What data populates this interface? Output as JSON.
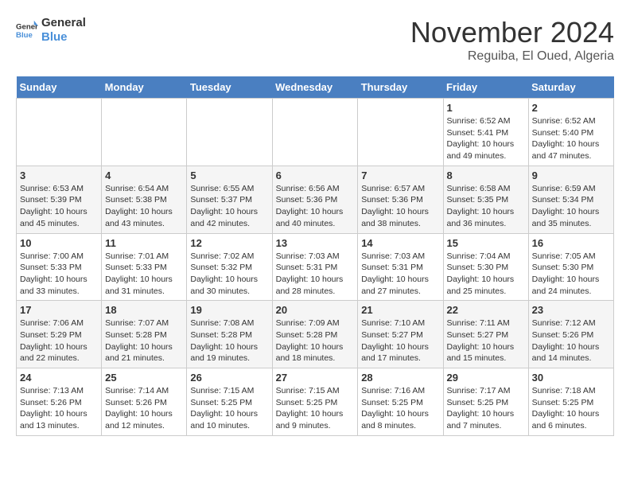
{
  "logo": {
    "line1": "General",
    "line2": "Blue"
  },
  "title": "November 2024",
  "subtitle": "Reguiba, El Oued, Algeria",
  "weekdays": [
    "Sunday",
    "Monday",
    "Tuesday",
    "Wednesday",
    "Thursday",
    "Friday",
    "Saturday"
  ],
  "weeks": [
    [
      {
        "day": "",
        "info": ""
      },
      {
        "day": "",
        "info": ""
      },
      {
        "day": "",
        "info": ""
      },
      {
        "day": "",
        "info": ""
      },
      {
        "day": "",
        "info": ""
      },
      {
        "day": "1",
        "info": "Sunrise: 6:52 AM\nSunset: 5:41 PM\nDaylight: 10 hours and 49 minutes."
      },
      {
        "day": "2",
        "info": "Sunrise: 6:52 AM\nSunset: 5:40 PM\nDaylight: 10 hours and 47 minutes."
      }
    ],
    [
      {
        "day": "3",
        "info": "Sunrise: 6:53 AM\nSunset: 5:39 PM\nDaylight: 10 hours and 45 minutes."
      },
      {
        "day": "4",
        "info": "Sunrise: 6:54 AM\nSunset: 5:38 PM\nDaylight: 10 hours and 43 minutes."
      },
      {
        "day": "5",
        "info": "Sunrise: 6:55 AM\nSunset: 5:37 PM\nDaylight: 10 hours and 42 minutes."
      },
      {
        "day": "6",
        "info": "Sunrise: 6:56 AM\nSunset: 5:36 PM\nDaylight: 10 hours and 40 minutes."
      },
      {
        "day": "7",
        "info": "Sunrise: 6:57 AM\nSunset: 5:36 PM\nDaylight: 10 hours and 38 minutes."
      },
      {
        "day": "8",
        "info": "Sunrise: 6:58 AM\nSunset: 5:35 PM\nDaylight: 10 hours and 36 minutes."
      },
      {
        "day": "9",
        "info": "Sunrise: 6:59 AM\nSunset: 5:34 PM\nDaylight: 10 hours and 35 minutes."
      }
    ],
    [
      {
        "day": "10",
        "info": "Sunrise: 7:00 AM\nSunset: 5:33 PM\nDaylight: 10 hours and 33 minutes."
      },
      {
        "day": "11",
        "info": "Sunrise: 7:01 AM\nSunset: 5:33 PM\nDaylight: 10 hours and 31 minutes."
      },
      {
        "day": "12",
        "info": "Sunrise: 7:02 AM\nSunset: 5:32 PM\nDaylight: 10 hours and 30 minutes."
      },
      {
        "day": "13",
        "info": "Sunrise: 7:03 AM\nSunset: 5:31 PM\nDaylight: 10 hours and 28 minutes."
      },
      {
        "day": "14",
        "info": "Sunrise: 7:03 AM\nSunset: 5:31 PM\nDaylight: 10 hours and 27 minutes."
      },
      {
        "day": "15",
        "info": "Sunrise: 7:04 AM\nSunset: 5:30 PM\nDaylight: 10 hours and 25 minutes."
      },
      {
        "day": "16",
        "info": "Sunrise: 7:05 AM\nSunset: 5:30 PM\nDaylight: 10 hours and 24 minutes."
      }
    ],
    [
      {
        "day": "17",
        "info": "Sunrise: 7:06 AM\nSunset: 5:29 PM\nDaylight: 10 hours and 22 minutes."
      },
      {
        "day": "18",
        "info": "Sunrise: 7:07 AM\nSunset: 5:28 PM\nDaylight: 10 hours and 21 minutes."
      },
      {
        "day": "19",
        "info": "Sunrise: 7:08 AM\nSunset: 5:28 PM\nDaylight: 10 hours and 19 minutes."
      },
      {
        "day": "20",
        "info": "Sunrise: 7:09 AM\nSunset: 5:28 PM\nDaylight: 10 hours and 18 minutes."
      },
      {
        "day": "21",
        "info": "Sunrise: 7:10 AM\nSunset: 5:27 PM\nDaylight: 10 hours and 17 minutes."
      },
      {
        "day": "22",
        "info": "Sunrise: 7:11 AM\nSunset: 5:27 PM\nDaylight: 10 hours and 15 minutes."
      },
      {
        "day": "23",
        "info": "Sunrise: 7:12 AM\nSunset: 5:26 PM\nDaylight: 10 hours and 14 minutes."
      }
    ],
    [
      {
        "day": "24",
        "info": "Sunrise: 7:13 AM\nSunset: 5:26 PM\nDaylight: 10 hours and 13 minutes."
      },
      {
        "day": "25",
        "info": "Sunrise: 7:14 AM\nSunset: 5:26 PM\nDaylight: 10 hours and 12 minutes."
      },
      {
        "day": "26",
        "info": "Sunrise: 7:15 AM\nSunset: 5:25 PM\nDaylight: 10 hours and 10 minutes."
      },
      {
        "day": "27",
        "info": "Sunrise: 7:15 AM\nSunset: 5:25 PM\nDaylight: 10 hours and 9 minutes."
      },
      {
        "day": "28",
        "info": "Sunrise: 7:16 AM\nSunset: 5:25 PM\nDaylight: 10 hours and 8 minutes."
      },
      {
        "day": "29",
        "info": "Sunrise: 7:17 AM\nSunset: 5:25 PM\nDaylight: 10 hours and 7 minutes."
      },
      {
        "day": "30",
        "info": "Sunrise: 7:18 AM\nSunset: 5:25 PM\nDaylight: 10 hours and 6 minutes."
      }
    ]
  ]
}
